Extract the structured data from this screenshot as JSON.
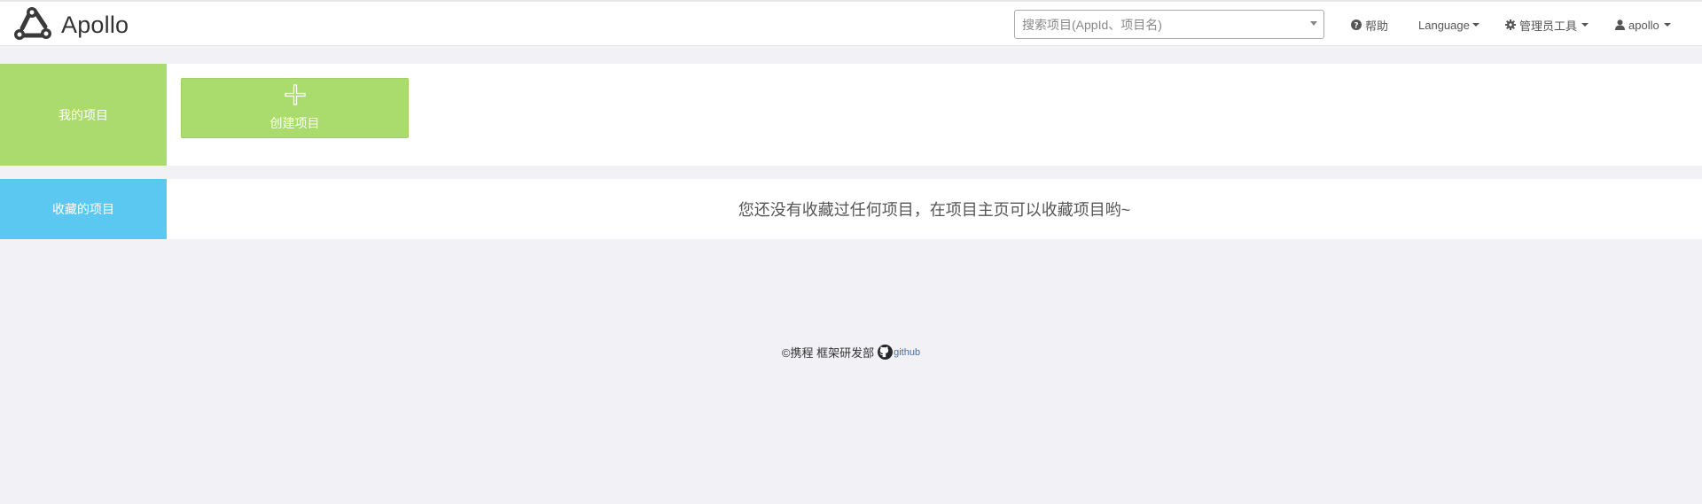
{
  "header": {
    "brand": "Apollo",
    "search_placeholder": "搜索项目(AppId、项目名)",
    "nav": {
      "help": "帮助",
      "language": "Language",
      "admin_tools": "管理员工具",
      "user": "apollo"
    }
  },
  "my_projects": {
    "label": "我的项目",
    "create_label": "创建项目"
  },
  "favorites": {
    "label": "收藏的项目",
    "empty_message": "您还没有收藏过任何项目，在项目主页可以收藏项目哟~"
  },
  "footer": {
    "copyright": "©携程 框架研发部",
    "github_label": "github"
  },
  "colors": {
    "my_projects_accent": "#abdb6e",
    "favorites_accent": "#5bc8f2",
    "page_background": "#f1f1f6"
  },
  "icons": {
    "brand": "apollo-logo",
    "help": "question-circle-icon",
    "admin": "gear-icon",
    "user": "user-icon",
    "create": "plus-icon",
    "github": "github-icon"
  }
}
